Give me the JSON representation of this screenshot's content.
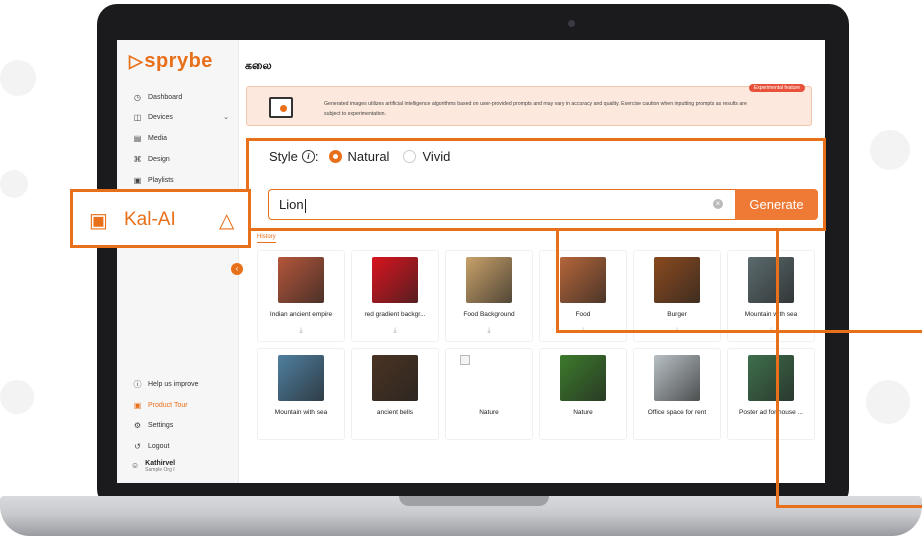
{
  "app": {
    "brand": "sprybe",
    "page_title": "கலை"
  },
  "sidebar": {
    "items": [
      {
        "label": "Dashboard",
        "icon": "clock-icon"
      },
      {
        "label": "Devices",
        "icon": "devices-icon",
        "has_chevron": true
      },
      {
        "label": "Media",
        "icon": "image-icon"
      },
      {
        "label": "Design",
        "icon": "design-icon"
      },
      {
        "label": "Playlists",
        "icon": "playlist-icon"
      }
    ],
    "bottom_items": [
      {
        "label": "Help us improve",
        "icon": "help-icon"
      },
      {
        "label": "Product Tour",
        "icon": "tour-icon"
      },
      {
        "label": "Settings",
        "icon": "gear-icon"
      },
      {
        "label": "Logout",
        "icon": "logout-icon"
      }
    ],
    "user": {
      "name": "Kathirvel",
      "org": "Sample Org I"
    }
  },
  "notice": {
    "badge": "Experimental feature",
    "text": "Generated images utilizes artificial intelligence algorithms based on user-provided prompts and may vary in accuracy and quality. Exercise caution when inputting prompts as results are subject to experimentation."
  },
  "style": {
    "label": "Style",
    "options": [
      "Natural",
      "Vivid"
    ],
    "selected": "Natural"
  },
  "prompt": {
    "value": "Lion",
    "generate_label": "Generate"
  },
  "kal_ai": {
    "label": "Kal-AI"
  },
  "history": {
    "tab_label": "History",
    "items": [
      {
        "label": "Indian ancient empire",
        "color": "#b4563a"
      },
      {
        "label": "red gradient backgr...",
        "color": "#d9141e"
      },
      {
        "label": "Food Background",
        "color": "#c9a26a"
      },
      {
        "label": "Food",
        "color": "#b5663a"
      },
      {
        "label": "Burger",
        "color": "#8a4a1e"
      },
      {
        "label": "Mountain with sea",
        "color": "#5b6b6e"
      },
      {
        "label": "Mountain with sea",
        "color": "#4f7fa0"
      },
      {
        "label": "ancient bells",
        "color": "#4a3322"
      },
      {
        "label": "Nature",
        "broken": true
      },
      {
        "label": "Nature",
        "color": "#3c7a2c"
      },
      {
        "label": "Office space for rent",
        "color": "#b8c0c4"
      },
      {
        "label": "Poster ad for house ...",
        "color": "#3e6f4c"
      }
    ]
  }
}
